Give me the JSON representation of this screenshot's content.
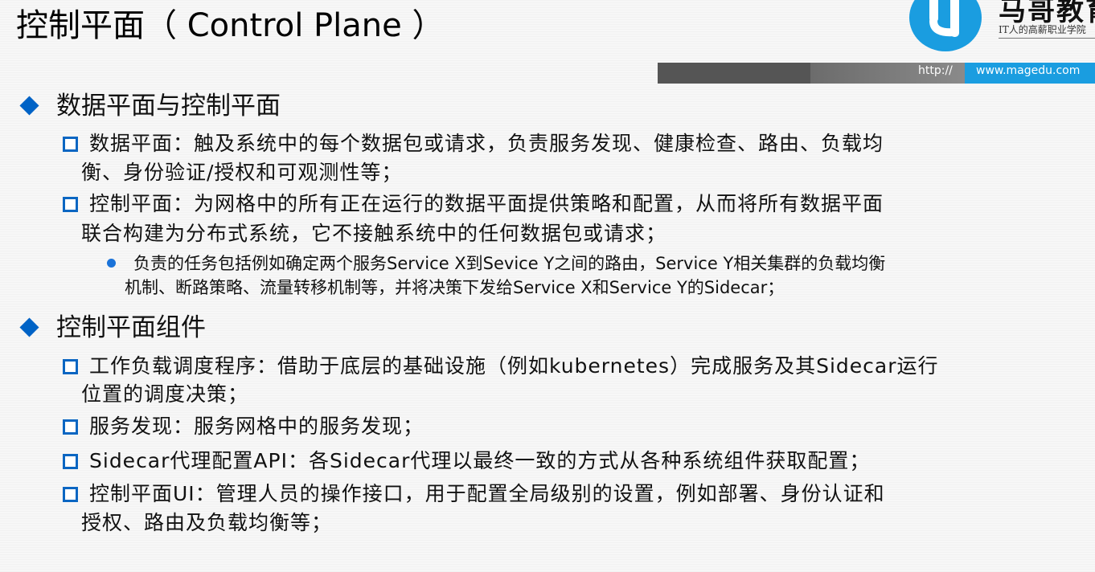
{
  "title": "控制平面（ Control Plane ）",
  "logo": {
    "name": "马哥教育",
    "tagline": "IT人的高薪职业学院"
  },
  "url_bar": {
    "prefix": "http://",
    "site": "www.magedu.com"
  },
  "sections": [
    {
      "heading": "数据平面与控制平面",
      "items": [
        {
          "lines": [
            "数据平面：触及系统中的每个数据包或请求，负责服务发现、健康检查、路由、负载均",
            "衡、身份验证/授权和可观测性等；"
          ]
        },
        {
          "lines": [
            "控制平面：为网格中的所有正在运行的数据平面提供策略和配置，从而将所有数据平面",
            "联合构建为分布式系统，它不接触系统中的任何数据包或请求；"
          ],
          "sub_lines": [
            "负责的任务包括例如确定两个服务Service X到Sevice Y之间的路由，Service Y相关集群的负载均衡",
            "机制、断路策略、流量转移机制等，并将决策下发给Service X和Service Y的Sidecar；"
          ]
        }
      ]
    },
    {
      "heading": "控制平面组件",
      "items": [
        {
          "lines": [
            "工作负载调度程序：借助于底层的基础设施（例如kubernetes）完成服务及其Sidecar运行",
            "位置的调度决策；"
          ]
        },
        {
          "lines": [
            "服务发现：服务网格中的服务发现；"
          ]
        },
        {
          "lines": [
            "Sidecar代理配置API：各Sidecar代理以最终一致的方式从各种系统组件获取配置；"
          ]
        },
        {
          "lines": [
            "控制平面UI：管理人员的操作接口，用于配置全局级别的设置，例如部署、身份认证和",
            "授权、路由及负载均衡等；"
          ]
        }
      ]
    }
  ]
}
